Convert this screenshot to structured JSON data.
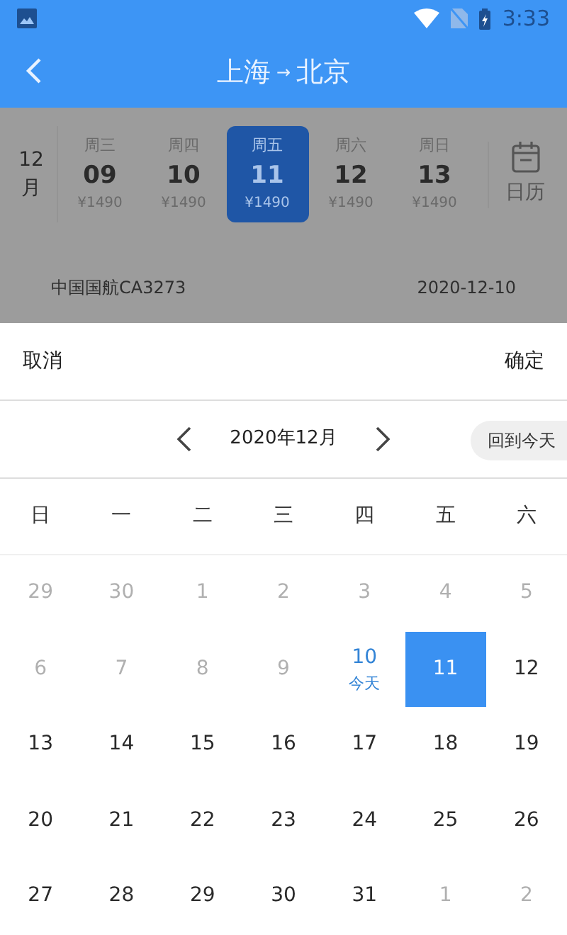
{
  "status_bar": {
    "time": "3:33"
  },
  "header": {
    "title_from": "上海",
    "arrow": "→",
    "title_to": "北京"
  },
  "date_strip": {
    "month": "12",
    "month_unit": "月",
    "calendar_label": "日历",
    "days": [
      {
        "weekday": "周三",
        "date": "09",
        "price": "¥1490",
        "selected": false
      },
      {
        "weekday": "周四",
        "date": "10",
        "price": "¥1490",
        "selected": false
      },
      {
        "weekday": "周五",
        "date": "11",
        "price": "¥1490",
        "selected": true
      },
      {
        "weekday": "周六",
        "date": "12",
        "price": "¥1490",
        "selected": false
      },
      {
        "weekday": "周日",
        "date": "13",
        "price": "¥1490",
        "selected": false
      }
    ]
  },
  "flight": {
    "airline": "中国国航CA3273",
    "date": "2020-12-10"
  },
  "sheet": {
    "cancel": "取消",
    "confirm": "确定",
    "month_title": "2020年12月",
    "today_button": "回到今天",
    "weekdays": [
      "日",
      "一",
      "二",
      "三",
      "四",
      "五",
      "六"
    ],
    "days": [
      {
        "label": "29",
        "muted": true,
        "selected": false
      },
      {
        "label": "30",
        "muted": true,
        "selected": false
      },
      {
        "label": "1",
        "muted": true,
        "selected": false
      },
      {
        "label": "2",
        "muted": true,
        "selected": false
      },
      {
        "label": "3",
        "muted": true,
        "selected": false
      },
      {
        "label": "4",
        "muted": true,
        "selected": false
      },
      {
        "label": "5",
        "muted": true,
        "selected": false
      },
      {
        "label": "6",
        "muted": true,
        "selected": false
      },
      {
        "label": "7",
        "muted": true,
        "selected": false
      },
      {
        "label": "8",
        "muted": true,
        "selected": false
      },
      {
        "label": "9",
        "muted": true,
        "selected": false
      },
      {
        "label": "10",
        "muted": false,
        "selected": false,
        "note": "今天"
      },
      {
        "label": "11",
        "muted": false,
        "selected": true
      },
      {
        "label": "12",
        "muted": false,
        "selected": false
      },
      {
        "label": "13",
        "muted": false,
        "selected": false
      },
      {
        "label": "14",
        "muted": false,
        "selected": false
      },
      {
        "label": "15",
        "muted": false,
        "selected": false
      },
      {
        "label": "16",
        "muted": false,
        "selected": false
      },
      {
        "label": "17",
        "muted": false,
        "selected": false
      },
      {
        "label": "18",
        "muted": false,
        "selected": false
      },
      {
        "label": "19",
        "muted": false,
        "selected": false
      },
      {
        "label": "20",
        "muted": false,
        "selected": false
      },
      {
        "label": "21",
        "muted": false,
        "selected": false
      },
      {
        "label": "22",
        "muted": false,
        "selected": false
      },
      {
        "label": "23",
        "muted": false,
        "selected": false
      },
      {
        "label": "24",
        "muted": false,
        "selected": false
      },
      {
        "label": "25",
        "muted": false,
        "selected": false
      },
      {
        "label": "26",
        "muted": false,
        "selected": false
      },
      {
        "label": "27",
        "muted": false,
        "selected": false
      },
      {
        "label": "28",
        "muted": false,
        "selected": false
      },
      {
        "label": "29",
        "muted": false,
        "selected": false
      },
      {
        "label": "30",
        "muted": false,
        "selected": false
      },
      {
        "label": "31",
        "muted": false,
        "selected": false
      },
      {
        "label": "1",
        "muted": true,
        "selected": false
      },
      {
        "label": "2",
        "muted": true,
        "selected": false
      }
    ]
  }
}
